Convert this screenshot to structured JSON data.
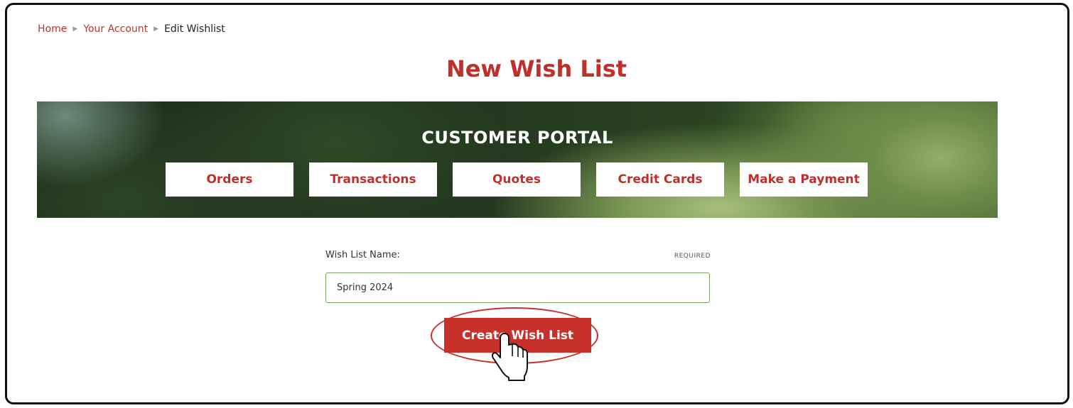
{
  "breadcrumb": {
    "home": "Home",
    "account": "Your Account",
    "current": "Edit Wishlist",
    "separator": "▶"
  },
  "page": {
    "title": "New Wish List"
  },
  "banner": {
    "heading": "CUSTOMER PORTAL",
    "nav": [
      {
        "label": "Orders"
      },
      {
        "label": "Transactions"
      },
      {
        "label": "Quotes"
      },
      {
        "label": "Credit Cards"
      },
      {
        "label": "Make a Payment"
      }
    ]
  },
  "form": {
    "name_label": "Wish List Name:",
    "required_text": "REQUIRED",
    "name_value": "Spring 2024",
    "submit_label": "Create Wish List"
  },
  "icons": {
    "cursor": "hand-pointer-icon",
    "separator": "triangle-right-icon"
  },
  "colors": {
    "brand_red": "#c8302b",
    "input_border": "#7aa25b"
  }
}
